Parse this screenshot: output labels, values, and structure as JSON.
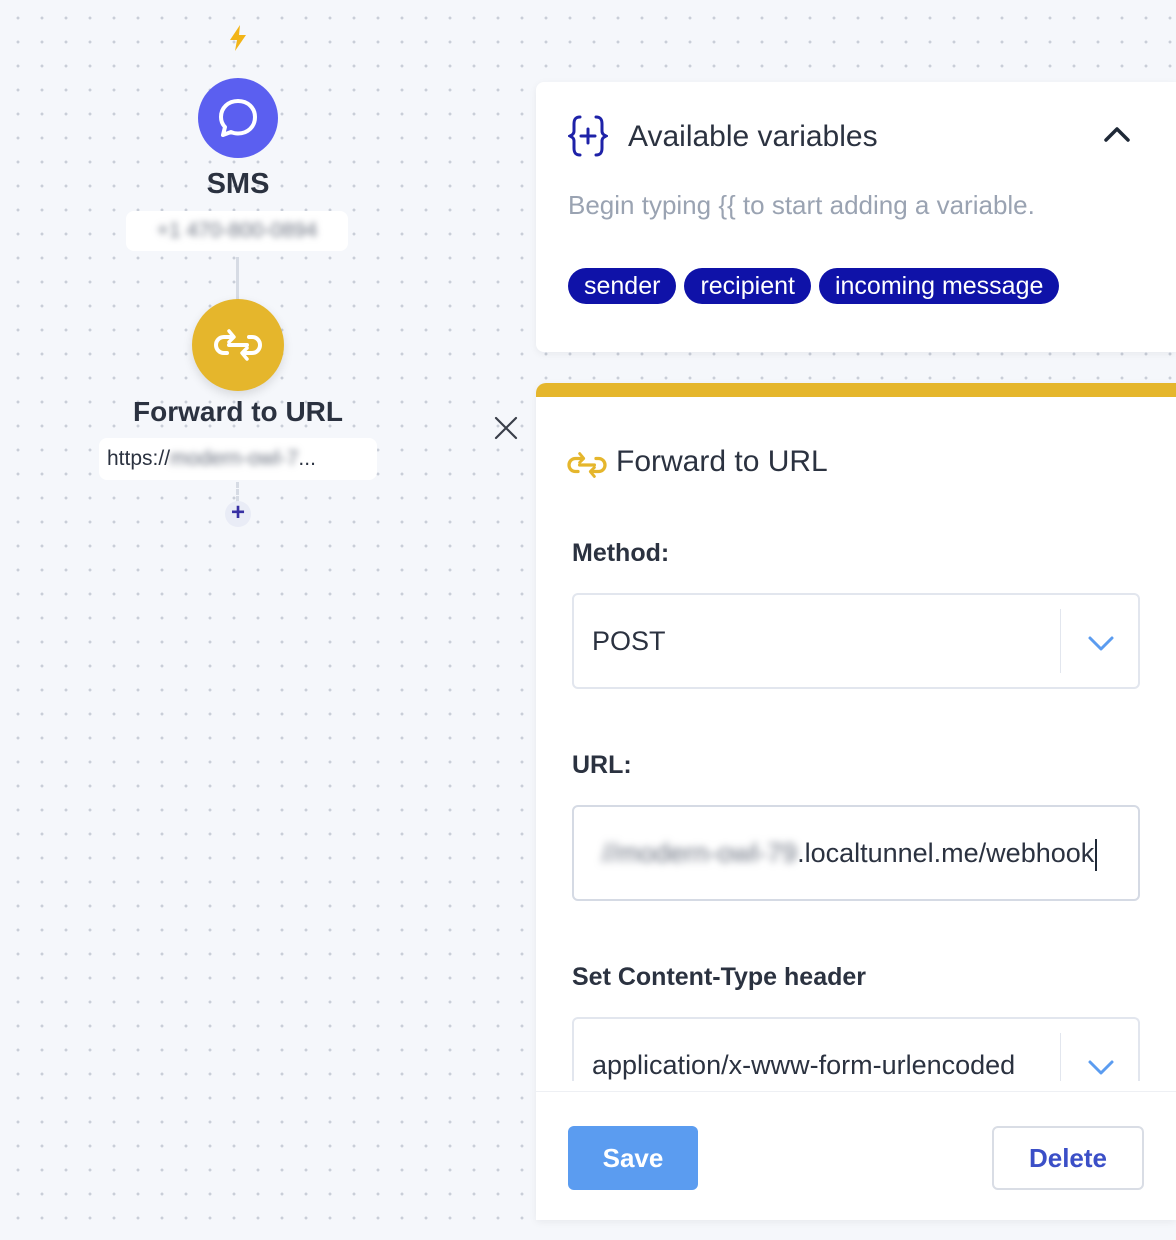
{
  "canvas": {
    "trigger_icon": "lightning-bolt-icon",
    "sms_node": {
      "icon": "chat-bubble-icon",
      "title": "SMS",
      "phone": "+1 470-800-0894"
    },
    "forward_node": {
      "icon": "link-icon",
      "title": "Forward to URL",
      "url_prefix": "https://",
      "url_blurred": "modern-owl-7",
      "url_ellipsis": "..."
    },
    "add_step_label": "+"
  },
  "variables_panel": {
    "icon": "braces-plus-icon",
    "title": "Available variables",
    "hint": "Begin typing {{ to start adding a variable.",
    "chips": [
      "sender",
      "recipient",
      "incoming message"
    ]
  },
  "forward_panel": {
    "title": "Forward to URL",
    "method": {
      "label": "Method:",
      "value": "POST"
    },
    "url": {
      "label": "URL:",
      "value_blurred": "//modern-owl-79",
      "value_visible": ".localtunnel.me/webhook"
    },
    "content_type": {
      "label": "Set Content-Type header",
      "value": "application/x-www-form-urlencoded"
    },
    "save_label": "Save",
    "delete_label": "Delete"
  },
  "colors": {
    "accent_yellow": "#e5b62c",
    "sms_purple": "#5b5ff0",
    "chip_navy": "#0f12a8",
    "save_blue": "#5b9cf0"
  }
}
